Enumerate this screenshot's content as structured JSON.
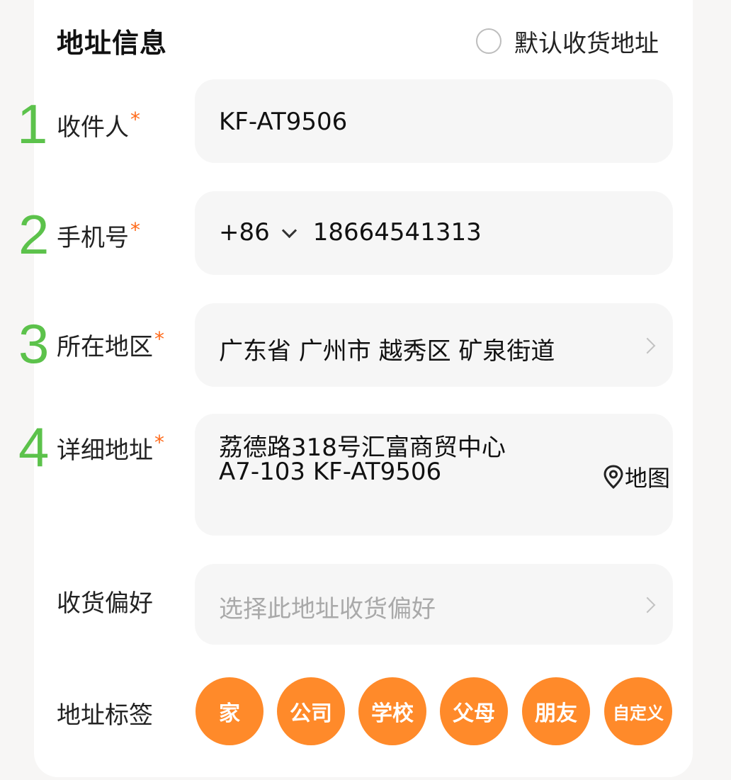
{
  "section_title": "地址信息",
  "default_address_label": "默认收货地址",
  "steps": [
    "1",
    "2",
    "3",
    "4"
  ],
  "required_mark": "*",
  "recipient": {
    "label": "收件人",
    "value": "KF-AT9506"
  },
  "phone": {
    "label": "手机号",
    "country_code": "+86",
    "value": "18664541313"
  },
  "region": {
    "label": "所在地区",
    "value": "广东省 广州市 越秀区 矿泉街道"
  },
  "detail_address": {
    "label": "详细地址",
    "line1": "荔德路318号汇富商贸中心",
    "line2": "A7-103 KF-AT9506",
    "map_label": "地图"
  },
  "preference": {
    "label": "收货偏好",
    "placeholder": "选择此地址收货偏好"
  },
  "tags": {
    "label": "地址标签",
    "items": [
      "家",
      "公司",
      "学校",
      "父母",
      "朋友",
      "自定义"
    ]
  },
  "colors": {
    "accent": "#ff8a2a",
    "step_number": "#5cc24b",
    "required": "#ff6a1a"
  }
}
